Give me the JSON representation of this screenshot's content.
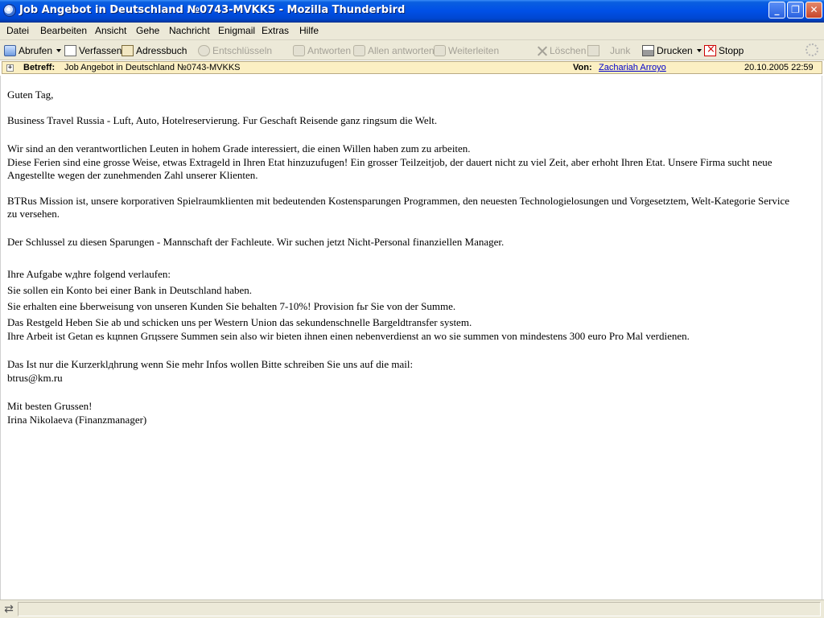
{
  "window": {
    "title": "Job Angebot in Deutschland №0743-MVKKS - Mozilla Thunderbird",
    "minimize": "_",
    "maximize": "❐",
    "close": "✕"
  },
  "menu": [
    "Datei",
    "Bearbeiten",
    "Ansicht",
    "Gehe",
    "Nachricht",
    "Enigmail",
    "Extras",
    "Hilfe"
  ],
  "toolbar": {
    "get": "Abrufen",
    "compose": "Verfassen",
    "addressbook": "Adressbuch",
    "decrypt": "Entschlüsseln",
    "reply": "Antworten",
    "reply_all": "Allen antworten",
    "forward": "Weiterleiten",
    "delete": "Löschen",
    "junk": "Junk",
    "print": "Drucken",
    "stop": "Stopp"
  },
  "header": {
    "expand": "+",
    "subject_label": "Betreff:",
    "subject": "Job Angebot in Deutschland №0743-MVKKS",
    "from_label": "Von:",
    "from": "Zachariah Arroyo",
    "date": "20.10.2005 22:59"
  },
  "body": {
    "greeting": "Guten Tag,",
    "p1": "Business Travel Russia - Luft, Auto, Hotelreservierung. Fur Geschaft Reisende ganz ringsum die Welt.",
    "p2_l1": "Wir sind an den verantwortlichen Leuten in hohem Grade interessiert, die einen Willen haben zum zu arbeiten.",
    "p2_l2": "Diese Ferien sind eine grosse Weise, etwas Extrageld in Ihren Etat hinzuzufugen! Ein grosser Teilzeitjob, der dauert nicht zu viel Zeit, aber erhoht Ihren Etat. Unsere Firma sucht neue",
    "p2_l3": "Angestellte wegen der zunehmenden Zahl unserer Klienten.",
    "p3_l1": "BTRus Mission ist, unsere korporativen Spielraumklienten mit bedeutenden Kostensparungen Programmen, den neuesten Technologielosungen und Vorgesetztem, Welt-Kategorie Service",
    "p3_l2": "zu versehen.",
    "p4": "Der Schlussel zu diesen Sparungen - Mannschaft der Fachleute. Wir suchen jetzt Nicht-Personal finanziellen Manager.",
    "p5_l1": "Ihre Aufgabe wдhre folgend verlaufen:",
    "p5_l2": "Sie sollen ein Konto bei einer Bank in Deutschland haben.",
    "p5_l3": "Sie erhalten eine Ьberweisung von unseren Kunden Sie behalten 7-10%! Provision fьr Sie von der Summe.",
    "p5_l4": "Das Restgeld Heben Sie ab und schicken uns per Western Union das sekundenschnelle Bargeldtransfer system.",
    "p5_l5": "Ihre Arbeit ist Getan es kцnnen Grцssere Summen sein also wir bieten ihnen einen nebenverdienst an wo sie summen von mindestens 300 euro Pro Mal verdienen.",
    "p6_l1": "Das Ist nur die Kurzerklдhrung wenn Sie mehr Infos wollen Bitte schreiben Sie uns auf die mail:",
    "p6_l2": "btrus@km.ru",
    "sign_l1": "Mit besten Grussen!",
    "sign_l2": "Irina Nikolaeva (Finanzmanager)"
  },
  "status": {
    "icon": "online-status-icon",
    "text": ""
  }
}
